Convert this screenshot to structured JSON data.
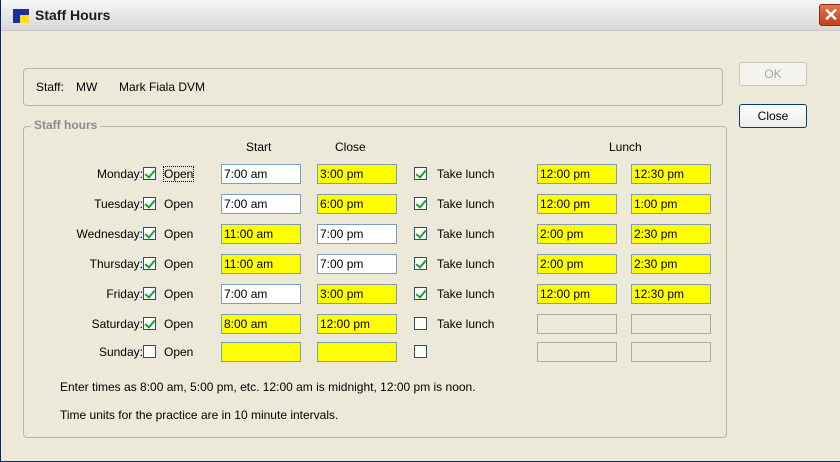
{
  "window": {
    "title": "Staff Hours",
    "close_glyph": "✕"
  },
  "staff": {
    "label": "Staff:",
    "code": "MW",
    "name": "Mark Fiala DVM"
  },
  "buttons": {
    "ok": "OK",
    "close": "Close"
  },
  "group_title": "Staff hours",
  "headers": {
    "start": "Start",
    "close": "Close",
    "lunch": "Lunch"
  },
  "open_label": "Open",
  "lunch_label": "Take lunch",
  "days": [
    {
      "day": "Monday:",
      "open": true,
      "start": "7:00 am",
      "close": "3:00 pm",
      "take_lunch": true,
      "lunch_start": "12:00 pm",
      "lunch_end": "12:30 pm"
    },
    {
      "day": "Tuesday:",
      "open": true,
      "start": "7:00 am",
      "close": "6:00 pm",
      "take_lunch": true,
      "lunch_start": "12:00 pm",
      "lunch_end": "1:00 pm"
    },
    {
      "day": "Wednesday:",
      "open": true,
      "start": "11:00 am",
      "close": "7:00 pm",
      "take_lunch": true,
      "lunch_start": "2:00 pm",
      "lunch_end": "2:30 pm"
    },
    {
      "day": "Thursday:",
      "open": true,
      "start": "11:00 am",
      "close": "7:00 pm",
      "take_lunch": true,
      "lunch_start": "2:00 pm",
      "lunch_end": "2:30 pm"
    },
    {
      "day": "Friday:",
      "open": true,
      "start": "7:00 am",
      "close": "3:00 pm",
      "take_lunch": true,
      "lunch_start": "12:00 pm",
      "lunch_end": "12:30 pm"
    },
    {
      "day": "Saturday:",
      "open": true,
      "start": "8:00 am",
      "close": "12:00 pm",
      "take_lunch": false,
      "lunch_start": "",
      "lunch_end": ""
    },
    {
      "day": "Sunday:",
      "open": false,
      "start": "",
      "close": "",
      "take_lunch": false,
      "lunch_start": "",
      "lunch_end": ""
    }
  ],
  "highlighted": {
    "start": [
      false,
      false,
      true,
      true,
      false,
      true,
      true
    ],
    "close": [
      true,
      true,
      false,
      false,
      true,
      true,
      true
    ],
    "lunch": [
      true,
      true,
      true,
      true,
      true,
      false,
      false
    ]
  },
  "notes": [
    "Enter times as 8:00 am, 5:00 pm, etc.  12:00 am is midnight, 12:00 pm is noon.",
    "Time units for the practice are in 10 minute intervals."
  ],
  "colors": {
    "highlight": "#ffff00",
    "check": "#21a121"
  }
}
